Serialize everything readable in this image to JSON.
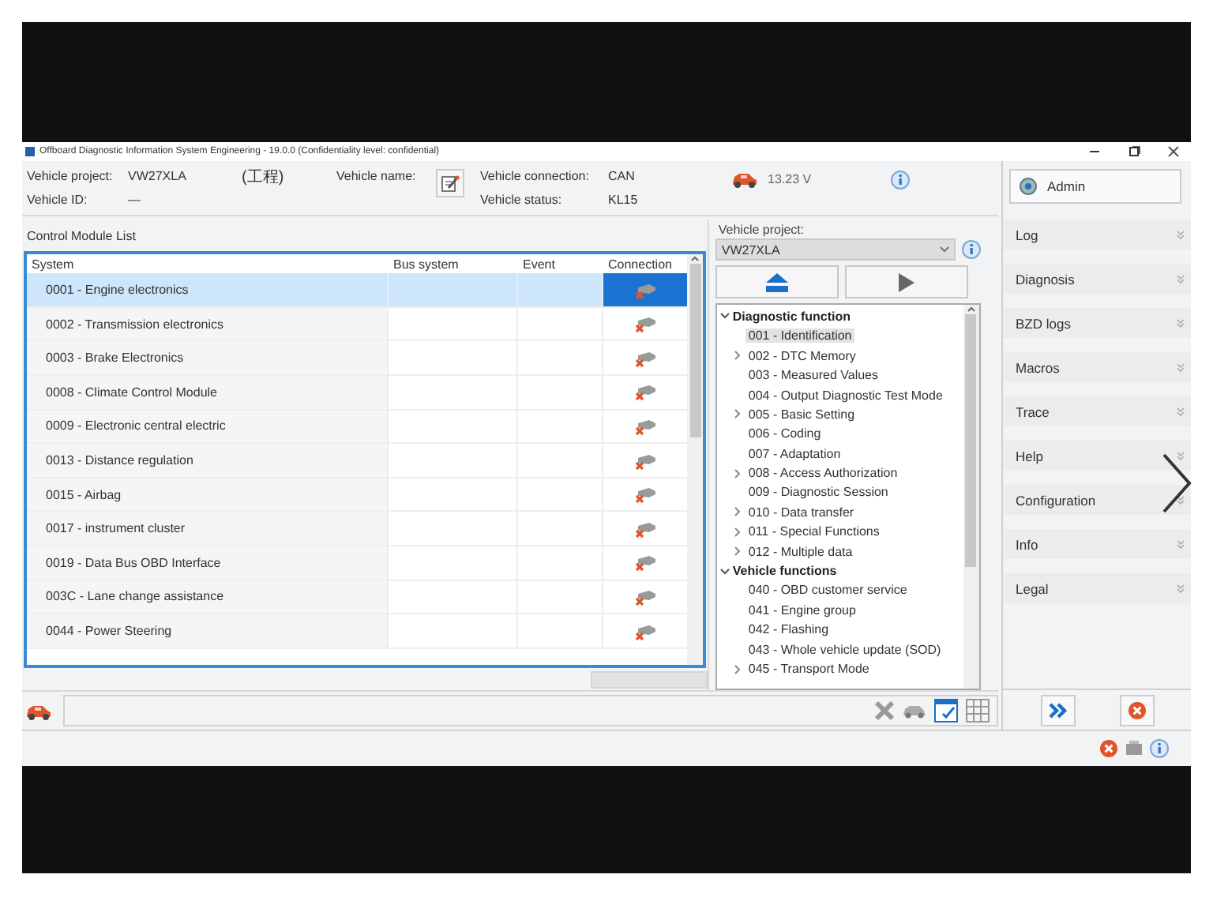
{
  "window": {
    "title": "Offboard Diagnostic Information System Engineering - 19.0.0 (Confidentiality level: confidential)"
  },
  "header": {
    "vehicle_project_label": "Vehicle project:",
    "vehicle_project_value": "VW27XLA",
    "project_note": "(工程)",
    "vehicle_name_label": "Vehicle name:",
    "vehicle_id_label": "Vehicle ID:",
    "vehicle_id_value": "—",
    "vehicle_connection_label": "Vehicle connection:",
    "vehicle_connection_value": "CAN",
    "vehicle_status_label": "Vehicle status:",
    "vehicle_status_value": "KL15",
    "voltage": "13.23 V"
  },
  "control_module_list": {
    "title": "Control Module List",
    "columns": [
      "System",
      "Bus system",
      "Event",
      "Connection"
    ],
    "rows": [
      {
        "system": "0001 - Engine electronics",
        "selected": true
      },
      {
        "system": "0002 - Transmission electronics",
        "selected": false
      },
      {
        "system": "0003 - Brake Electronics",
        "selected": false
      },
      {
        "system": "0008 - Climate Control Module",
        "selected": false
      },
      {
        "system": "0009 - Electronic central electric",
        "selected": false
      },
      {
        "system": "0013 - Distance regulation",
        "selected": false
      },
      {
        "system": "0015 - Airbag",
        "selected": false
      },
      {
        "system": "0017 - instrument cluster",
        "selected": false
      },
      {
        "system": "0019 - Data Bus OBD Interface",
        "selected": false
      },
      {
        "system": "003C - Lane change assistance",
        "selected": false
      },
      {
        "system": "0044 - Power Steering",
        "selected": false
      }
    ]
  },
  "functions": {
    "vehicle_project_label": "Vehicle project:",
    "vehicle_project_value": "VW27XLA",
    "tree": [
      {
        "label": "Diagnostic function",
        "expanded": true,
        "children": [
          {
            "label": "001 - Identification",
            "kind": "leaf",
            "selected": true
          },
          {
            "label": "002 - DTC Memory",
            "kind": "folder",
            "selected": false
          },
          {
            "label": "003 - Measured Values",
            "kind": "leaf",
            "selected": false
          },
          {
            "label": "004 - Output Diagnostic Test Mode",
            "kind": "leaf",
            "selected": false
          },
          {
            "label": "005 - Basic Setting",
            "kind": "folder",
            "selected": false
          },
          {
            "label": "006 - Coding",
            "kind": "leaf",
            "selected": false
          },
          {
            "label": "007 - Adaptation",
            "kind": "leaf",
            "selected": false
          },
          {
            "label": "008 - Access Authorization",
            "kind": "folder",
            "selected": false
          },
          {
            "label": "009 - Diagnostic Session",
            "kind": "leaf",
            "selected": false
          },
          {
            "label": "010 - Data transfer",
            "kind": "folder",
            "selected": false
          },
          {
            "label": "011 - Special Functions",
            "kind": "folder",
            "selected": false
          },
          {
            "label": "012 - Multiple data",
            "kind": "folder",
            "selected": false
          }
        ]
      },
      {
        "label": "Vehicle functions",
        "expanded": true,
        "children": [
          {
            "label": "040 - OBD customer service",
            "kind": "leaf",
            "selected": false
          },
          {
            "label": "041 - Engine group",
            "kind": "leaf",
            "selected": false
          },
          {
            "label": "042 - Flashing",
            "kind": "leaf",
            "selected": false
          },
          {
            "label": "043 - Whole vehicle update (SOD)",
            "kind": "leaf",
            "selected": false
          },
          {
            "label": "045 - Transport Mode",
            "kind": "folder",
            "selected": false
          }
        ]
      }
    ]
  },
  "sidebar": {
    "user": "Admin",
    "items": [
      "Log",
      "Diagnosis",
      "BZD logs",
      "Macros",
      "Trace",
      "Help",
      "Configuration",
      "Info",
      "Legal"
    ]
  }
}
